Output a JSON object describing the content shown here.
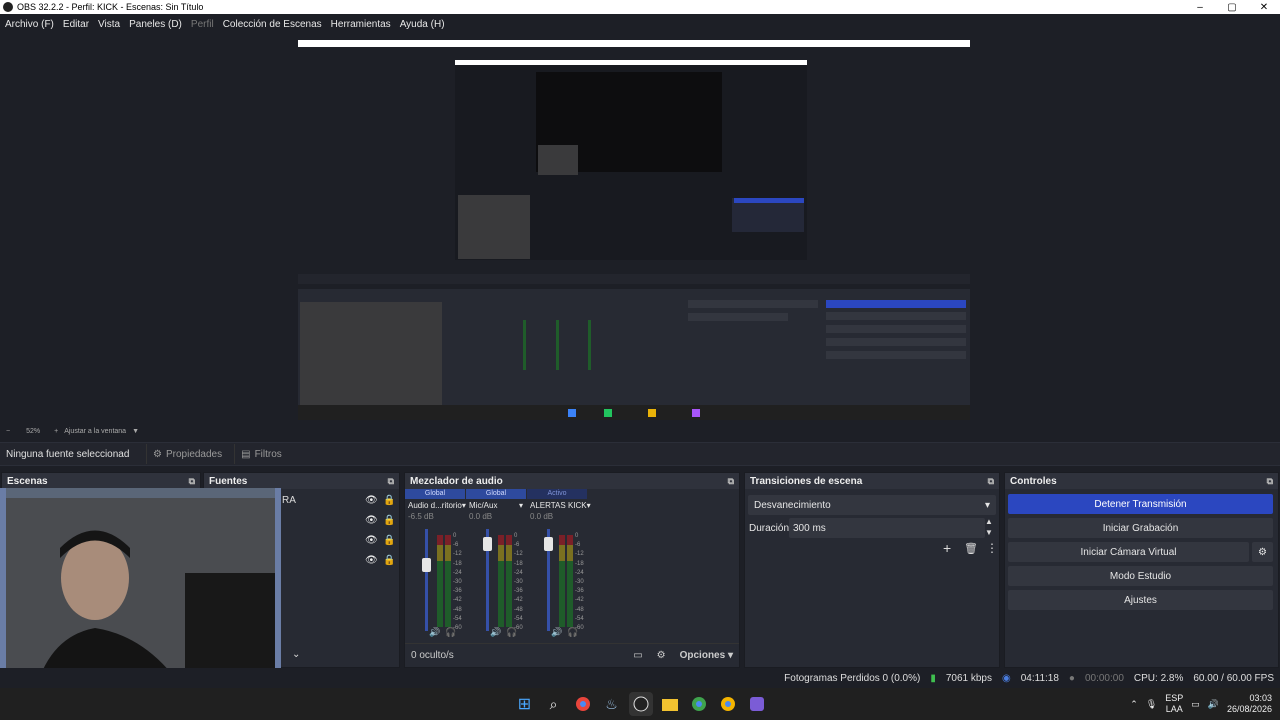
{
  "window": {
    "title": "OBS 32.2.2 - Perfil: KICK - Escenas: Sin Título",
    "minimize": "–",
    "maximize": "▢",
    "close": "✕"
  },
  "menu": [
    {
      "label": "Archivo (F)"
    },
    {
      "label": "Editar"
    },
    {
      "label": "Vista"
    },
    {
      "label": "Paneles (D)"
    },
    {
      "label": "Perfil",
      "disabled": true
    },
    {
      "label": "Colección de Escenas"
    },
    {
      "label": "Herramientas"
    },
    {
      "label": "Ayuda (H)"
    }
  ],
  "zoom": {
    "minus": "−",
    "value": "52%",
    "plus": "+",
    "fit": "Ajustar a la ventana"
  },
  "source_bar": {
    "no_source": "Ninguna fuente seleccionad",
    "properties": "Propiedades",
    "filters": "Filtros"
  },
  "docks": {
    "scenes": {
      "title": "Escenas"
    },
    "sources": {
      "title": "Fuentes",
      "partial_label": "RA"
    },
    "mixer": {
      "title": "Mezclador de audio",
      "channels": [
        {
          "scope": "Global",
          "name": "Audio d...ritorio",
          "db": "-6.5 dB",
          "level": 0.72
        },
        {
          "scope": "Global",
          "name": "Mic/Aux",
          "db": "0.0 dB",
          "level": 0.92
        },
        {
          "scope": "Activo",
          "name": "ALERTAS KICK",
          "db": "0.0 dB",
          "level": 0.92
        }
      ],
      "ticks": [
        "0",
        "-6",
        "-12",
        "-18",
        "-24",
        "-30",
        "-36",
        "-42",
        "-48",
        "-54",
        "-60"
      ],
      "hidden": "0 oculto/s",
      "options": "Opciones"
    },
    "transitions": {
      "title": "Transiciones de escena",
      "selected": "Desvanecimiento",
      "duration_label": "Duración",
      "duration_value": "300 ms"
    },
    "controls": {
      "title": "Controles",
      "buttons": [
        {
          "label": "Detener Transmisión",
          "primary": true
        },
        {
          "label": "Iniciar Grabación"
        },
        {
          "label": "Iniciar Cámara Virtual"
        },
        {
          "label": "Modo Estudio"
        },
        {
          "label": "Ajustes"
        }
      ]
    }
  },
  "status": {
    "dropped": "Fotogramas Perdidos 0 (0.0%)",
    "kbps": "7061 kbps",
    "stream_time": "04:11:18",
    "rec_time": "00:00:00",
    "cpu": "CPU: 2.8%",
    "fps": "60.00 / 60.00 FPS"
  },
  "taskbar": {
    "lang_top": "ESP",
    "lang_bottom": "LAA",
    "time": "03:03",
    "date": "26/08/2026"
  },
  "colors": {
    "accent": "#2b47c0",
    "background": "#1d1f26",
    "dock": "#272a33"
  }
}
